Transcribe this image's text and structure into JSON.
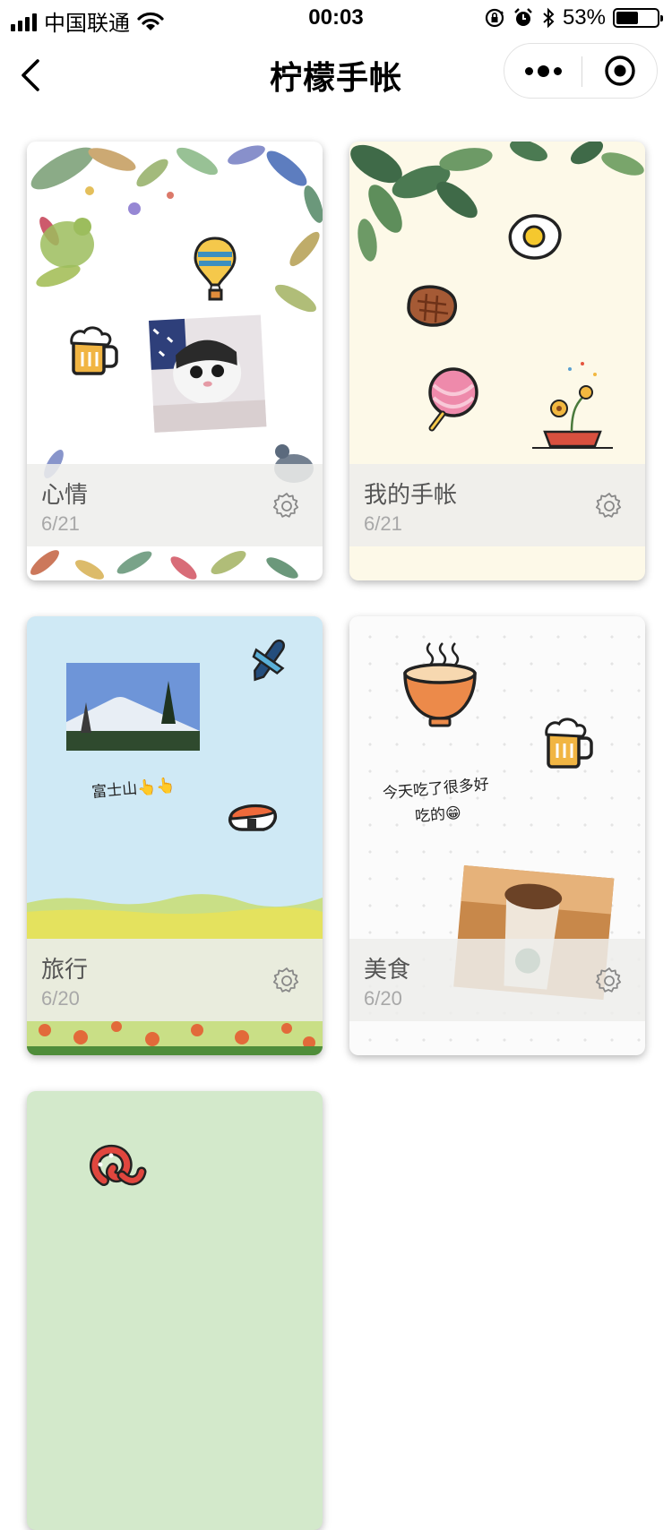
{
  "status_bar": {
    "carrier": "中国联通",
    "time": "00:03",
    "battery_percent": "53%",
    "battery_level": 0.53
  },
  "nav": {
    "title": "柠檬手帐",
    "back_icon": "chevron-left-icon",
    "more_icon": "ellipsis-icon",
    "close_icon": "target-icon"
  },
  "cards": [
    {
      "name": "心情",
      "date": "6/21",
      "theme": "floral",
      "icons": [
        "hot-air-balloon-icon",
        "beer-mug-icon",
        "bird-icon",
        "cat-photo"
      ]
    },
    {
      "name": "我的手帐",
      "date": "6/21",
      "theme": "leaves",
      "icons": [
        "fried-egg-icon",
        "steak-icon",
        "lollipop-icon",
        "flower-pot-icon"
      ]
    },
    {
      "name": "旅行",
      "date": "6/20",
      "theme": "sky",
      "caption": "富士山👆👆",
      "icons": [
        "mount-fuji-photo",
        "airplane-icon",
        "sushi-icon"
      ]
    },
    {
      "name": "美食",
      "date": "6/20",
      "theme": "dots",
      "caption_line1": "今天吃了很多好",
      "caption_line2": "吃的😁",
      "icons": [
        "soup-bowl-icon",
        "beer-mug-icon",
        "coffee-photo"
      ]
    },
    {
      "name": "",
      "date": "",
      "theme": "green",
      "icons": [
        "octopus-icon"
      ]
    }
  ],
  "colors": {
    "card2_bg": "#fdf9e8",
    "card3_bg": "#cfe9f5",
    "card5_bg": "#d3e9cb",
    "info_overlay": "#eeeeeb"
  }
}
